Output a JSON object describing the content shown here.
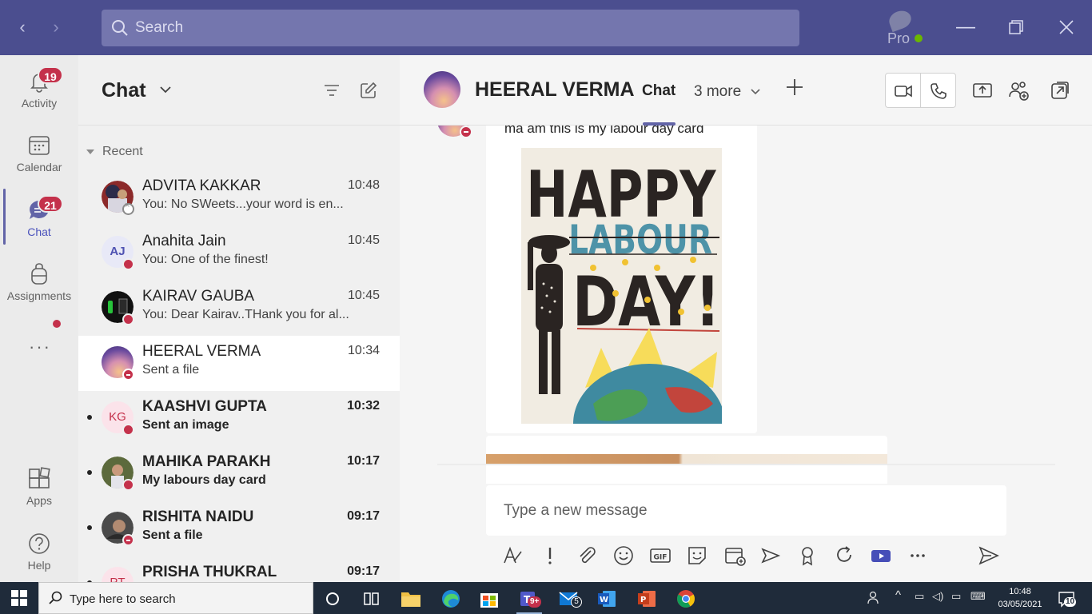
{
  "titlebar": {
    "search_placeholder": "Search",
    "profile_label": "Pro",
    "back_icon": "chevron-left-icon",
    "forward_icon": "chevron-right-icon"
  },
  "rail": {
    "items": [
      {
        "label": "Activity",
        "badge": "19",
        "icon": "bell-icon"
      },
      {
        "label": "Calendar",
        "badge": "",
        "icon": "calendar-icon"
      },
      {
        "label": "Chat",
        "badge": "21",
        "icon": "chat-icon"
      },
      {
        "label": "Assignments",
        "badge": "",
        "icon": "backpack-icon"
      },
      {
        "label": "Apps",
        "badge": "",
        "icon": "apps-icon"
      },
      {
        "label": "Help",
        "badge": "",
        "icon": "help-icon"
      }
    ],
    "more_label": "···"
  },
  "chatlist": {
    "title": "Chat",
    "section": "Recent",
    "rows": [
      {
        "name": "ADVITA KAKKAR",
        "time": "10:48",
        "preview": "You: No SWeets...your word is en...",
        "initials": "",
        "unread": false,
        "status": "offline"
      },
      {
        "name": "Anahita Jain",
        "time": "10:45",
        "preview": "You: One of the finest!",
        "initials": "AJ",
        "unread": false,
        "status": "busy"
      },
      {
        "name": "KAIRAV GAUBA",
        "time": "10:45",
        "preview": "You: Dear Kairav..THank you for al...",
        "initials": "",
        "unread": false,
        "status": "busy"
      },
      {
        "name": "HEERAL VERMA",
        "time": "10:34",
        "preview": "Sent a file",
        "initials": "",
        "unread": false,
        "status": "dnd",
        "selected": true
      },
      {
        "name": "KAASHVI GUPTA",
        "time": "10:32",
        "preview": "Sent an image",
        "initials": "KG",
        "unread": true,
        "status": "busy"
      },
      {
        "name": "MAHIKA PARAKH",
        "time": "10:17",
        "preview": "My labours day card",
        "initials": "",
        "unread": true,
        "status": "busy"
      },
      {
        "name": "RISHITA NAIDU",
        "time": "09:17",
        "preview": "Sent a file",
        "initials": "",
        "unread": true,
        "status": "dnd"
      },
      {
        "name": "PRISHA THUKRAL",
        "time": "09:17",
        "preview": "",
        "initials": "PT",
        "unread": true,
        "status": "busy"
      }
    ]
  },
  "conversation": {
    "contact_name": "HEERAL VERMA",
    "active_tab": "Chat",
    "more_tabs": "3 more",
    "message_text": "ma am this is my labour day card",
    "card_text": {
      "line1": "HAPPY",
      "line2": "LABOUR",
      "line3": "DAY!"
    },
    "compose_placeholder": "Type a new message"
  },
  "taskbar": {
    "search_placeholder": "Type here to search",
    "time": "10:48",
    "date": "03/05/2021",
    "notif_count": "10",
    "teams_badge": "9+",
    "mail_badge": "5"
  },
  "colors": {
    "titlebar": "#4b4e8f",
    "accent": "#6264a7",
    "badge": "#c4314b",
    "taskbar": "#1f2b3a"
  }
}
